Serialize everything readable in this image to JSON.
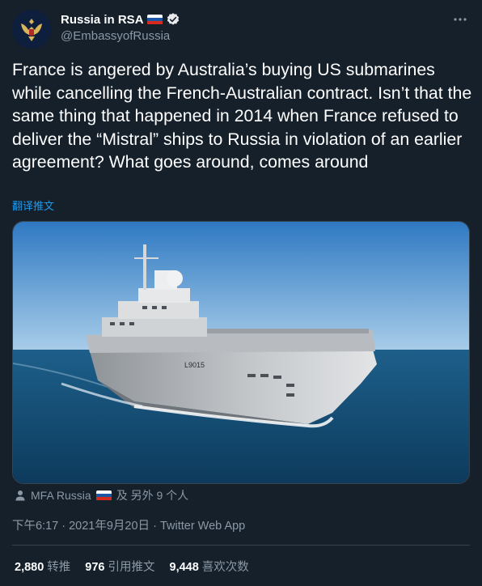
{
  "author": {
    "display_name": "Russia in RSA",
    "handle": "@EmbassyofRussia",
    "flag_icon": "russian-flag-icon",
    "verified_icon": "verified-badge-icon"
  },
  "tweet": {
    "text": "France is angered by Australia’s buying US submarines while cancelling the French-Australian contract. Isn’t that the same thing that happened in 2014 when France refused to deliver the “Mistral” ships to Russia in violation of an earlier agreement? What goes around, comes around",
    "translate_label": "翻译推文",
    "media": {
      "hull_marking": "L9015"
    }
  },
  "tagged": {
    "name": "MFA Russia",
    "suffix": "及 另外 9 个人"
  },
  "meta": {
    "timestamp": "下午6:17 · 2021年9月20日 · Twitter Web App"
  },
  "stats": {
    "retweets": {
      "count": "2,880",
      "label": "转推"
    },
    "quotes": {
      "count": "976",
      "label": "引用推文"
    },
    "likes": {
      "count": "9,448",
      "label": "喜欢次数"
    }
  },
  "colors": {
    "background": "#15202b",
    "link": "#1d9bf0",
    "secondary_text": "#8b98a5",
    "border": "#38444d"
  }
}
